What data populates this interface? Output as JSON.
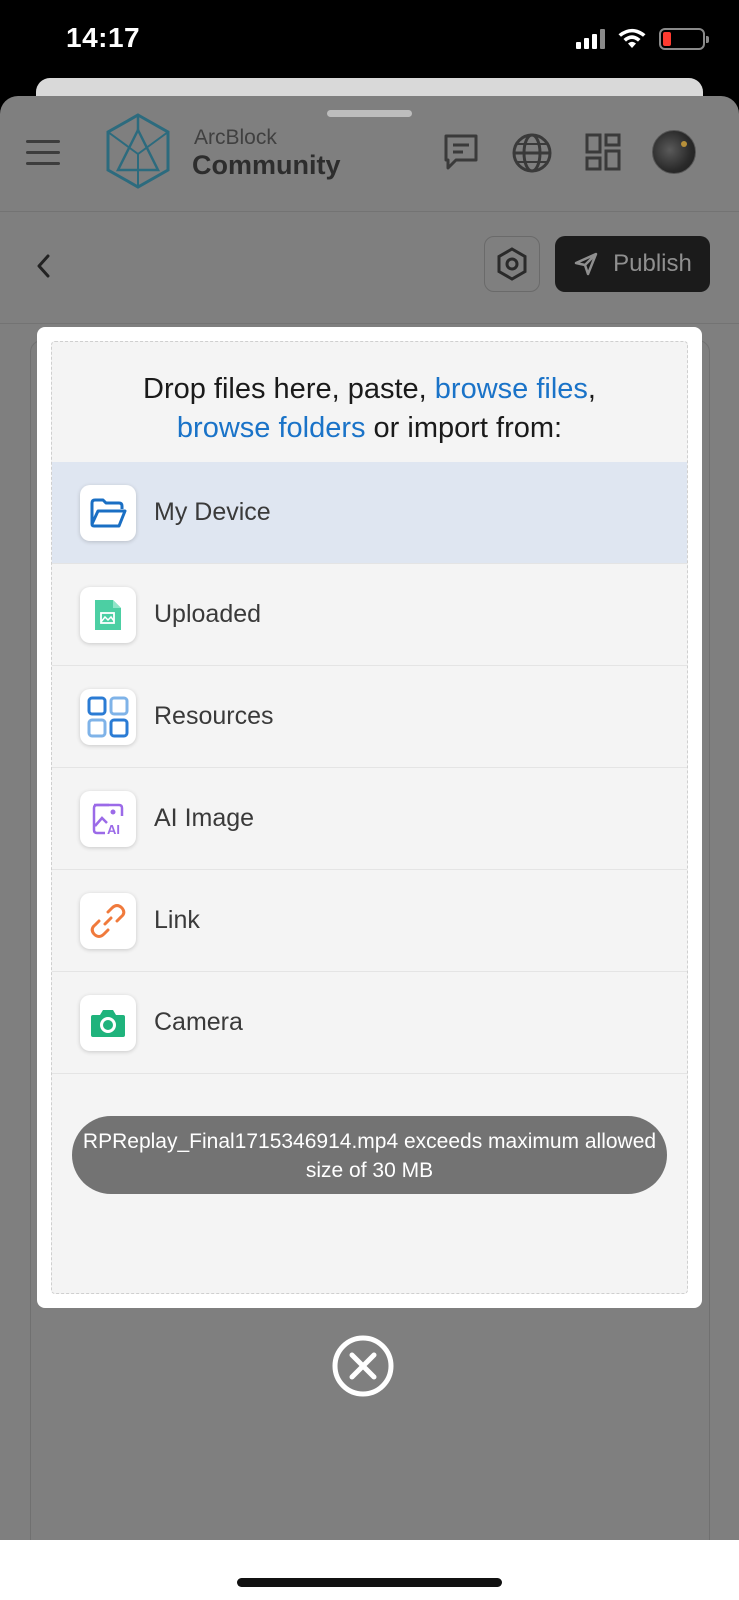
{
  "status_bar": {
    "time": "14:17"
  },
  "header": {
    "brand_top": "ArcBlock",
    "brand_bottom": "Community"
  },
  "toolbar": {
    "publish_label": "Publish"
  },
  "uploader": {
    "title_parts": {
      "p1": "Drop files here, paste, ",
      "link1": "browse files",
      "p2": ",",
      "link2": "browse folders",
      "p3": " or import from:"
    },
    "sources": [
      {
        "label": "My Device",
        "icon": "folder-open-icon",
        "active": true,
        "color": "#1a6fc4"
      },
      {
        "label": "Uploaded",
        "icon": "image-file-icon",
        "active": false,
        "color": "#4ccfa3"
      },
      {
        "label": "Resources",
        "icon": "grid-icon",
        "active": false,
        "color": "#2a7bd4"
      },
      {
        "label": "AI Image",
        "icon": "ai-image-icon",
        "active": false,
        "color": "#9b6ae8"
      },
      {
        "label": "Link",
        "icon": "link-icon",
        "active": false,
        "color": "#f07a3c"
      },
      {
        "label": "Camera",
        "icon": "camera-icon",
        "active": false,
        "color": "#1fb37c"
      }
    ],
    "toast": "RPReplay_Final1715346914.mp4 exceeds maximum allowed size of 30 MB"
  },
  "colors": {
    "link": "#1a73c8",
    "active_row": "#dfe6f1",
    "publish_bg": "#1b1b1b"
  }
}
